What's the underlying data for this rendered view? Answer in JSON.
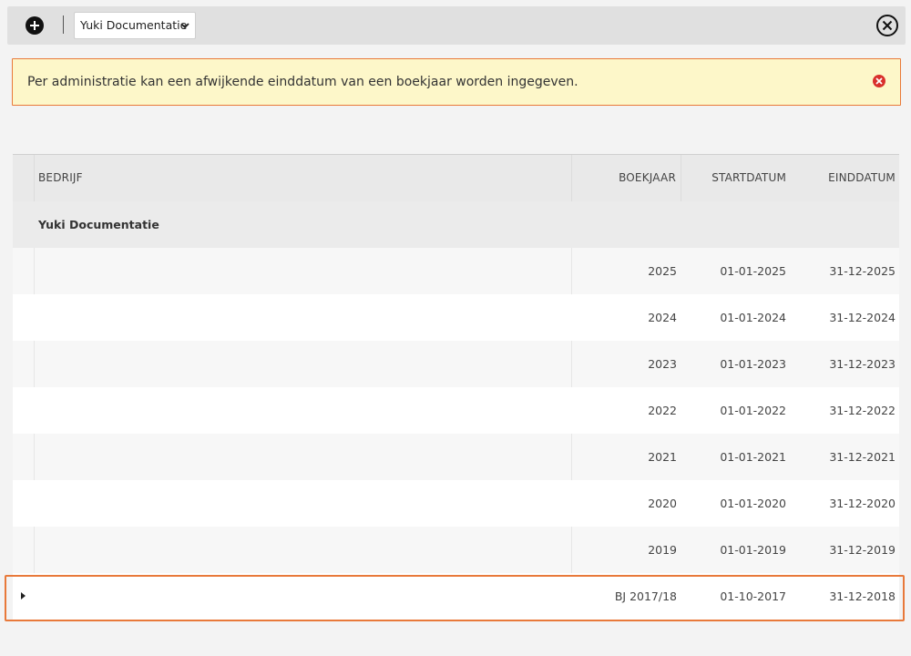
{
  "toolbar": {
    "add_icon": "plus-circle-icon",
    "company_select_value": "Yuki Documentatie",
    "close_icon": "close-circle-icon"
  },
  "alert": {
    "message": "Per administratie kan een afwijkende einddatum van een boekjaar worden ingegeven.",
    "close_icon": "error-close-icon",
    "close_color": "#d9302c",
    "border_color": "#e8793a",
    "background": "#fdf7c9"
  },
  "table": {
    "columns": {
      "company": "BEDRIJF",
      "year": "BOEKJAAR",
      "start": "STARTDATUM",
      "end": "EINDDATUM"
    },
    "group": "Yuki Documentatie",
    "rows": [
      {
        "year": "2025",
        "start": "01-01-2025",
        "end": "31-12-2025"
      },
      {
        "year": "2024",
        "start": "01-01-2024",
        "end": "31-12-2024"
      },
      {
        "year": "2023",
        "start": "01-01-2023",
        "end": "31-12-2023"
      },
      {
        "year": "2022",
        "start": "01-01-2022",
        "end": "31-12-2022"
      },
      {
        "year": "2021",
        "start": "01-01-2021",
        "end": "31-12-2021"
      },
      {
        "year": "2020",
        "start": "01-01-2020",
        "end": "31-12-2020"
      },
      {
        "year": "2019",
        "start": "01-01-2019",
        "end": "31-12-2019"
      },
      {
        "year": "BJ 2017/18",
        "start": "01-10-2017",
        "end": "31-12-2018"
      }
    ],
    "highlight_color": "#e8793a"
  }
}
